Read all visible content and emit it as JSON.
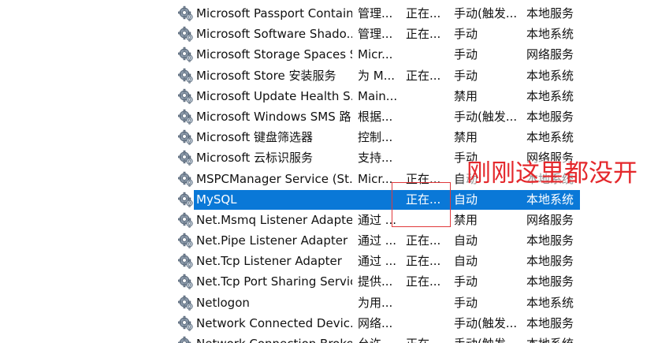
{
  "services": {
    "rows": [
      {
        "name": "Microsoft Passport Container",
        "description": "管理...",
        "status": "正在...",
        "startup_type": "手动(触发...",
        "log_on_as": "本地服务",
        "selected": false
      },
      {
        "name": "Microsoft Software Shado...",
        "description": "管理...",
        "status": "正在...",
        "startup_type": "手动",
        "log_on_as": "本地系统",
        "selected": false
      },
      {
        "name": "Microsoft Storage Spaces S...",
        "description": "Micr...",
        "status": "",
        "startup_type": "手动",
        "log_on_as": "网络服务",
        "selected": false
      },
      {
        "name": "Microsoft Store 安装服务",
        "description": "为 M...",
        "status": "正在...",
        "startup_type": "手动",
        "log_on_as": "本地系统",
        "selected": false
      },
      {
        "name": "Microsoft Update Health S...",
        "description": "Main...",
        "status": "",
        "startup_type": "禁用",
        "log_on_as": "本地系统",
        "selected": false
      },
      {
        "name": "Microsoft Windows SMS 路...",
        "description": "根据...",
        "status": "",
        "startup_type": "手动(触发...",
        "log_on_as": "本地服务",
        "selected": false
      },
      {
        "name": "Microsoft 键盘筛选器",
        "description": "控制...",
        "status": "",
        "startup_type": "禁用",
        "log_on_as": "本地系统",
        "selected": false
      },
      {
        "name": "Microsoft 云标识服务",
        "description": "支持...",
        "status": "",
        "startup_type": "手动",
        "log_on_as": "网络服务",
        "selected": false
      },
      {
        "name": "MSPCManager Service (St...",
        "description": "Micr...",
        "status": "正在...",
        "startup_type": "自动",
        "log_on_as": "本地系统",
        "selected": false
      },
      {
        "name": "MySQL",
        "description": "",
        "status": "正在...",
        "startup_type": "自动",
        "log_on_as": "本地系统",
        "selected": true
      },
      {
        "name": "Net.Msmq Listener Adapter",
        "description": "通过 ...",
        "status": "",
        "startup_type": "禁用",
        "log_on_as": "网络服务",
        "selected": false
      },
      {
        "name": "Net.Pipe Listener Adapter",
        "description": "通过 ...",
        "status": "正在...",
        "startup_type": "自动",
        "log_on_as": "本地服务",
        "selected": false
      },
      {
        "name": "Net.Tcp Listener Adapter",
        "description": "通过 ...",
        "status": "正在...",
        "startup_type": "自动",
        "log_on_as": "本地服务",
        "selected": false
      },
      {
        "name": "Net.Tcp Port Sharing Service",
        "description": "提供...",
        "status": "正在...",
        "startup_type": "手动",
        "log_on_as": "本地服务",
        "selected": false
      },
      {
        "name": "Netlogon",
        "description": "为用...",
        "status": "",
        "startup_type": "手动",
        "log_on_as": "本地系统",
        "selected": false
      },
      {
        "name": "Network Connected Devic...",
        "description": "网络...",
        "status": "",
        "startup_type": "手动(触发...",
        "log_on_as": "本地服务",
        "selected": false
      },
      {
        "name": "Network Connection Broker",
        "description": "允许...",
        "status": "正在...",
        "startup_type": "手动(触发...",
        "log_on_as": "本地系统",
        "selected": false
      }
    ]
  },
  "annotation": {
    "text": "刚刚这里都没开",
    "color": "#e4282c"
  },
  "colors": {
    "selection": "#0a78d7",
    "text": "#111111",
    "annotation_box": "#e0393b"
  },
  "icons": {
    "service": "gears-icon"
  }
}
